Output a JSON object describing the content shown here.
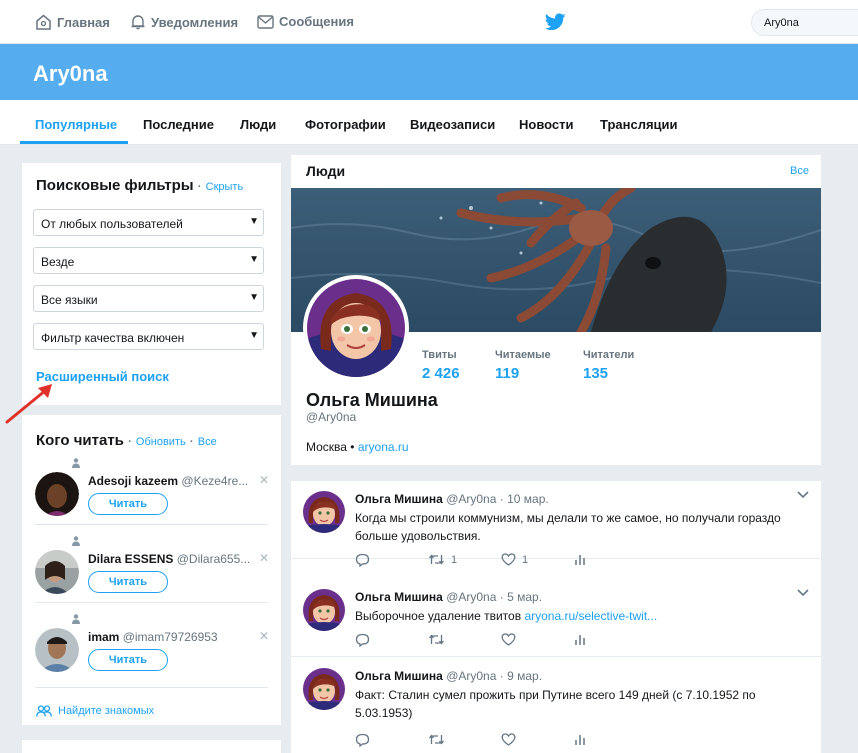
{
  "topnav": {
    "home": "Главная",
    "notifications": "Уведомления",
    "messages": "Сообщения",
    "search_value": "Ary0na"
  },
  "banner": {
    "title": "Ary0na"
  },
  "tabs": [
    "Популярные",
    "Последние",
    "Люди",
    "Фотографии",
    "Видеозаписи",
    "Новости",
    "Трансляции"
  ],
  "filters": {
    "title": "Поисковые фильтры",
    "hide": "Скрыть",
    "selects": [
      "От любых пользователей",
      "Везде",
      "Все языки",
      "Фильтр качества включен"
    ],
    "advanced": "Расширенный поиск"
  },
  "who_to_follow": {
    "title": "Кого читать",
    "refresh": "Обновить",
    "all": "Все",
    "users": [
      {
        "name": "Adesoji kazeem",
        "handle": "@Keze4re...",
        "button": "Читать"
      },
      {
        "name": "Dilara ESSENS",
        "handle": "@Dilara655...",
        "button": "Читать"
      },
      {
        "name": "imam",
        "handle": "@imam79726953",
        "button": "Читать"
      }
    ],
    "find_friends": "Найдите знакомых"
  },
  "people": {
    "title": "Люди",
    "all": "Все",
    "profile": {
      "name": "Ольга Мишина",
      "handle": "@Ary0na",
      "location": "Москва",
      "site": "aryona.ru",
      "stats": [
        {
          "label": "Твиты",
          "value": "2 426"
        },
        {
          "label": "Читаемые",
          "value": "119"
        },
        {
          "label": "Читатели",
          "value": "135"
        }
      ]
    }
  },
  "tweets": [
    {
      "name": "Ольга Мишина",
      "handle": "@Ary0na",
      "date": "10 мар.",
      "text": "Когда мы строили коммунизм, мы делали то же самое, но получали гораздо больше удовольствия.",
      "link": "",
      "retweets": "1",
      "likes": "1"
    },
    {
      "name": "Ольга Мишина",
      "handle": "@Ary0na",
      "date": "5 мар.",
      "text": "Выборочное удаление твитов ",
      "link": "aryona.ru/selective-twit...",
      "retweets": "",
      "likes": ""
    },
    {
      "name": "Ольга Мишина",
      "handle": "@Ary0na",
      "date": "9 мар.",
      "text": "Факт: Сталин сумел прожить при Путине всего 149 дней (с 7.10.1952 по 5.03.1953)",
      "link": "",
      "retweets": "",
      "likes": ""
    }
  ],
  "colors": {
    "accent": "#1da1f2",
    "banner": "#55acee",
    "background": "#e6ecf0"
  }
}
